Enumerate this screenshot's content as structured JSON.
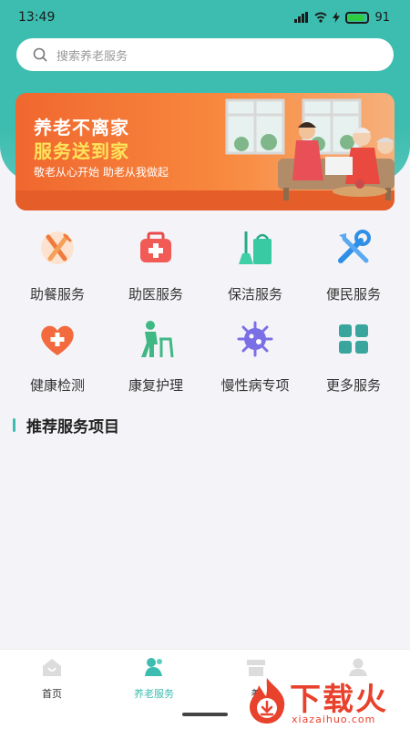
{
  "status_bar": {
    "time": "13:49",
    "battery": "91"
  },
  "search": {
    "placeholder": "搜索养老服务"
  },
  "banner": {
    "title_line1": "养老不离家",
    "title_line2": "服务送到家",
    "subtitle": "敬老从心开始  助老从我做起"
  },
  "services": [
    {
      "label": "助餐服务",
      "icon": "fork-knife-icon"
    },
    {
      "label": "助医服务",
      "icon": "medical-kit-icon"
    },
    {
      "label": "保洁服务",
      "icon": "broom-bag-icon"
    },
    {
      "label": "便民服务",
      "icon": "tools-icon"
    },
    {
      "label": "健康检测",
      "icon": "heart-plus-icon"
    },
    {
      "label": "康复护理",
      "icon": "elder-walker-icon"
    },
    {
      "label": "慢性病专项",
      "icon": "virus-icon"
    },
    {
      "label": "更多服务",
      "icon": "grid-icon"
    }
  ],
  "section": {
    "title": "推荐服务项目"
  },
  "tabbar": {
    "tabs": [
      {
        "label": "首页",
        "icon": "home-icon"
      },
      {
        "label": "养老服务",
        "icon": "elder-service-icon"
      },
      {
        "label": "养",
        "icon": "shop-icon"
      },
      {
        "label": "",
        "icon": "user-icon"
      }
    ]
  },
  "watermark": {
    "text": "下载火",
    "url": "xiazaihuo.com"
  },
  "colors": {
    "accent": "#3dbdaf",
    "banner": "#f0672f",
    "watermark": "#e8412c"
  }
}
